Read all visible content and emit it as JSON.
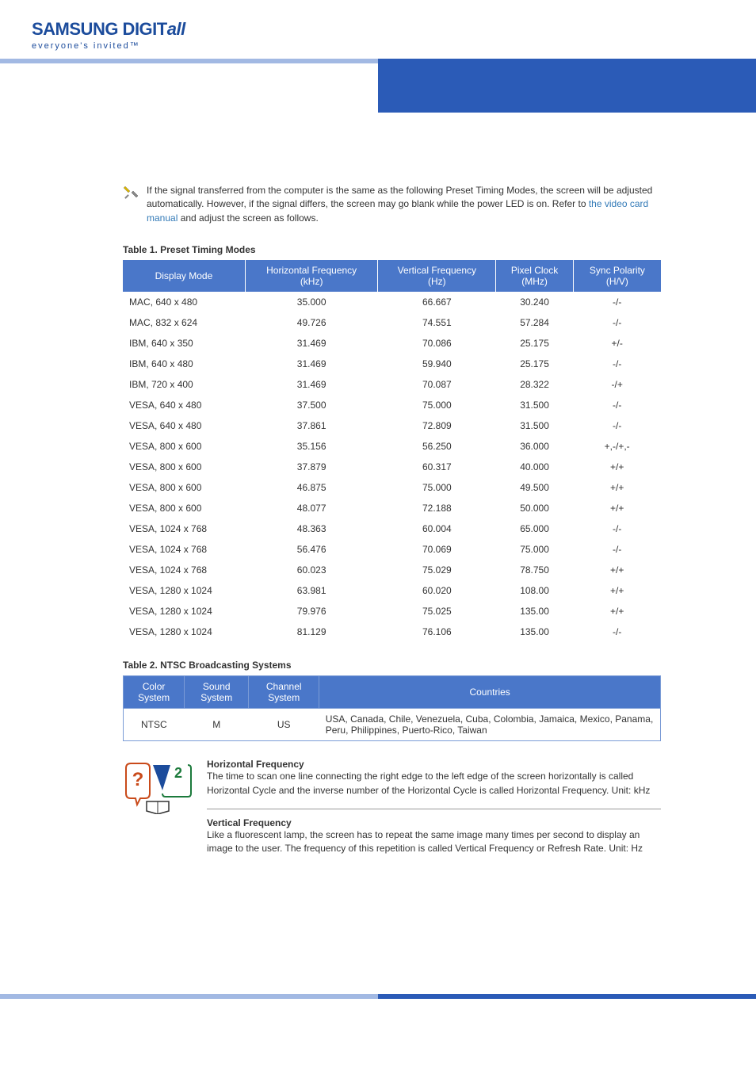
{
  "header": {
    "brand_part1": "SAMSUNG DIGIT",
    "brand_part2": "all",
    "tagline": "everyone's invited™"
  },
  "intro": {
    "text_before_link": "If the signal transferred from the computer is the same as the following Preset Timing Modes, the screen will be adjusted automatically. However, if the signal differs, the screen may go blank while the power LED is on. Refer to ",
    "link_text": "the video card manual",
    "text_after_link": " and adjust the screen as follows."
  },
  "table1": {
    "title": "Table 1. Preset Timing Modes",
    "headers": {
      "display_mode": "Display Mode",
      "hfreq_main": "Horizontal Frequency",
      "hfreq_sub": "(kHz)",
      "vfreq_main": "Vertical Frequency",
      "vfreq_sub": "(Hz)",
      "pixel_main": "Pixel Clock",
      "pixel_sub": "(MHz)",
      "sync_main": "Sync Polarity",
      "sync_sub": "(H/V)"
    },
    "rows": [
      {
        "mode": "MAC, 640 x 480",
        "h": "35.000",
        "v": "66.667",
        "p": "30.240",
        "s": "-/-"
      },
      {
        "mode": "MAC, 832 x 624",
        "h": "49.726",
        "v": "74.551",
        "p": "57.284",
        "s": "-/-"
      },
      {
        "mode": "IBM, 640 x 350",
        "h": "31.469",
        "v": "70.086",
        "p": "25.175",
        "s": "+/-"
      },
      {
        "mode": "IBM, 640 x 480",
        "h": "31.469",
        "v": "59.940",
        "p": "25.175",
        "s": "-/-"
      },
      {
        "mode": "IBM, 720 x 400",
        "h": "31.469",
        "v": "70.087",
        "p": "28.322",
        "s": "-/+"
      },
      {
        "mode": "VESA, 640 x 480",
        "h": "37.500",
        "v": "75.000",
        "p": "31.500",
        "s": "-/-"
      },
      {
        "mode": "VESA, 640 x 480",
        "h": "37.861",
        "v": "72.809",
        "p": "31.500",
        "s": "-/-"
      },
      {
        "mode": "VESA, 800 x 600",
        "h": "35.156",
        "v": "56.250",
        "p": "36.000",
        "s": "+,-/+,-"
      },
      {
        "mode": "VESA, 800 x 600",
        "h": "37.879",
        "v": "60.317",
        "p": "40.000",
        "s": "+/+"
      },
      {
        "mode": "VESA, 800 x 600",
        "h": "46.875",
        "v": "75.000",
        "p": "49.500",
        "s": "+/+"
      },
      {
        "mode": "VESA, 800 x 600",
        "h": "48.077",
        "v": "72.188",
        "p": "50.000",
        "s": "+/+"
      },
      {
        "mode": "VESA, 1024 x 768",
        "h": "48.363",
        "v": "60.004",
        "p": "65.000",
        "s": "-/-"
      },
      {
        "mode": "VESA, 1024 x 768",
        "h": "56.476",
        "v": "70.069",
        "p": "75.000",
        "s": "-/-"
      },
      {
        "mode": "VESA, 1024 x 768",
        "h": "60.023",
        "v": "75.029",
        "p": "78.750",
        "s": "+/+"
      },
      {
        "mode": "VESA, 1280 x 1024",
        "h": "63.981",
        "v": "60.020",
        "p": "108.00",
        "s": "+/+"
      },
      {
        "mode": "VESA, 1280 x 1024",
        "h": "79.976",
        "v": "75.025",
        "p": "135.00",
        "s": "+/+"
      },
      {
        "mode": "VESA, 1280 x 1024",
        "h": "81.129",
        "v": "76.106",
        "p": "135.00",
        "s": "-/-"
      }
    ]
  },
  "table2": {
    "title": "Table 2. NTSC Broadcasting Systems",
    "headers": {
      "color": "Color System",
      "sound": "Sound System",
      "channel": "Channel System",
      "countries": "Countries"
    },
    "row": {
      "color": "NTSC",
      "sound": "M",
      "channel": "US",
      "countries": "USA, Canada, Chile, Venezuela, Cuba, Colombia, Jamaica, Mexico, Panama, Peru, Philippines, Puerto-Rico, Taiwan"
    }
  },
  "definitions": {
    "hfreq_title": "Horizontal Frequency",
    "hfreq_body": "The time to scan one line connecting the right edge to the left edge of the screen horizontally is called Horizontal Cycle and the inverse number of the Horizontal Cycle is called Horizontal Frequency. Unit: kHz",
    "vfreq_title": "Vertical Frequency",
    "vfreq_body": "Like a fluorescent lamp, the screen has to repeat the same image many times per second to display an image to the user. The frequency of this repetition is called Vertical Frequency or Refresh Rate. Unit: Hz"
  }
}
